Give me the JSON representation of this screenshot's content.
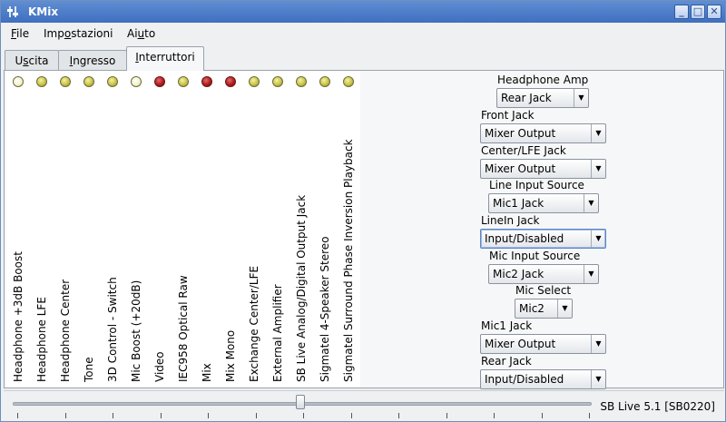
{
  "window": {
    "title": "KMix",
    "buttons": {
      "minimize": "_",
      "maximize": "□",
      "close": "✕"
    }
  },
  "menubar": [
    {
      "pre": "",
      "acc": "F",
      "post": "ile"
    },
    {
      "pre": "Imp",
      "acc": "o",
      "post": "stazioni"
    },
    {
      "pre": "Ai",
      "acc": "u",
      "post": "to"
    }
  ],
  "tabs": [
    {
      "pre": "U",
      "acc": "s",
      "post": "cita",
      "active": false
    },
    {
      "pre": "",
      "acc": "I",
      "post": "ngresso",
      "active": false
    },
    {
      "pre": "",
      "acc": "I",
      "post": "nterruttori",
      "active": true
    }
  ],
  "switches": [
    {
      "label": "Headphone +3dB Boost",
      "led": "white"
    },
    {
      "label": "Headphone LFE",
      "led": "yellow"
    },
    {
      "label": "Headphone Center",
      "led": "yellow"
    },
    {
      "label": "Tone",
      "led": "yellow"
    },
    {
      "label": "3D Control - Switch",
      "led": "yellow"
    },
    {
      "label": "Mic Boost (+20dB)",
      "led": "white"
    },
    {
      "label": "Video",
      "led": "red"
    },
    {
      "label": "IEC958 Optical Raw",
      "led": "yellow"
    },
    {
      "label": "Mix",
      "led": "red"
    },
    {
      "label": "Mix Mono",
      "led": "red"
    },
    {
      "label": "Exchange Center/LFE",
      "led": "yellow"
    },
    {
      "label": "External Amplifier",
      "led": "yellow"
    },
    {
      "label": "SB Live Analog/Digital Output Jack",
      "led": "yellow"
    },
    {
      "label": "Sigmatel 4-Speaker Stereo",
      "led": "yellow"
    },
    {
      "label": "Sigmatel Surround Phase Inversion Playback",
      "led": "yellow"
    }
  ],
  "enums": [
    {
      "label": "Headphone Amp",
      "value": "Rear Jack"
    },
    {
      "label": "Front Jack",
      "value": "Mixer Output"
    },
    {
      "label": "Center/LFE Jack",
      "value": "Mixer Output"
    },
    {
      "label": "Line Input Source",
      "value": "Mic1 Jack"
    },
    {
      "label": "LineIn Jack",
      "value": "Input/Disabled"
    },
    {
      "label": "Mic Input Source",
      "value": "Mic2 Jack"
    },
    {
      "label": "Mic Select",
      "value": "Mic2"
    },
    {
      "label": "Mic1 Jack",
      "value": "Mixer Output"
    },
    {
      "label": "Rear Jack",
      "value": "Input/Disabled"
    }
  ],
  "status": {
    "card_name": "SB Live 5.1 [SB0220]"
  },
  "colors": {
    "led_on": "#b11a1a",
    "led_off": "#c9c24a",
    "titlebar": "#4f7fcb"
  }
}
